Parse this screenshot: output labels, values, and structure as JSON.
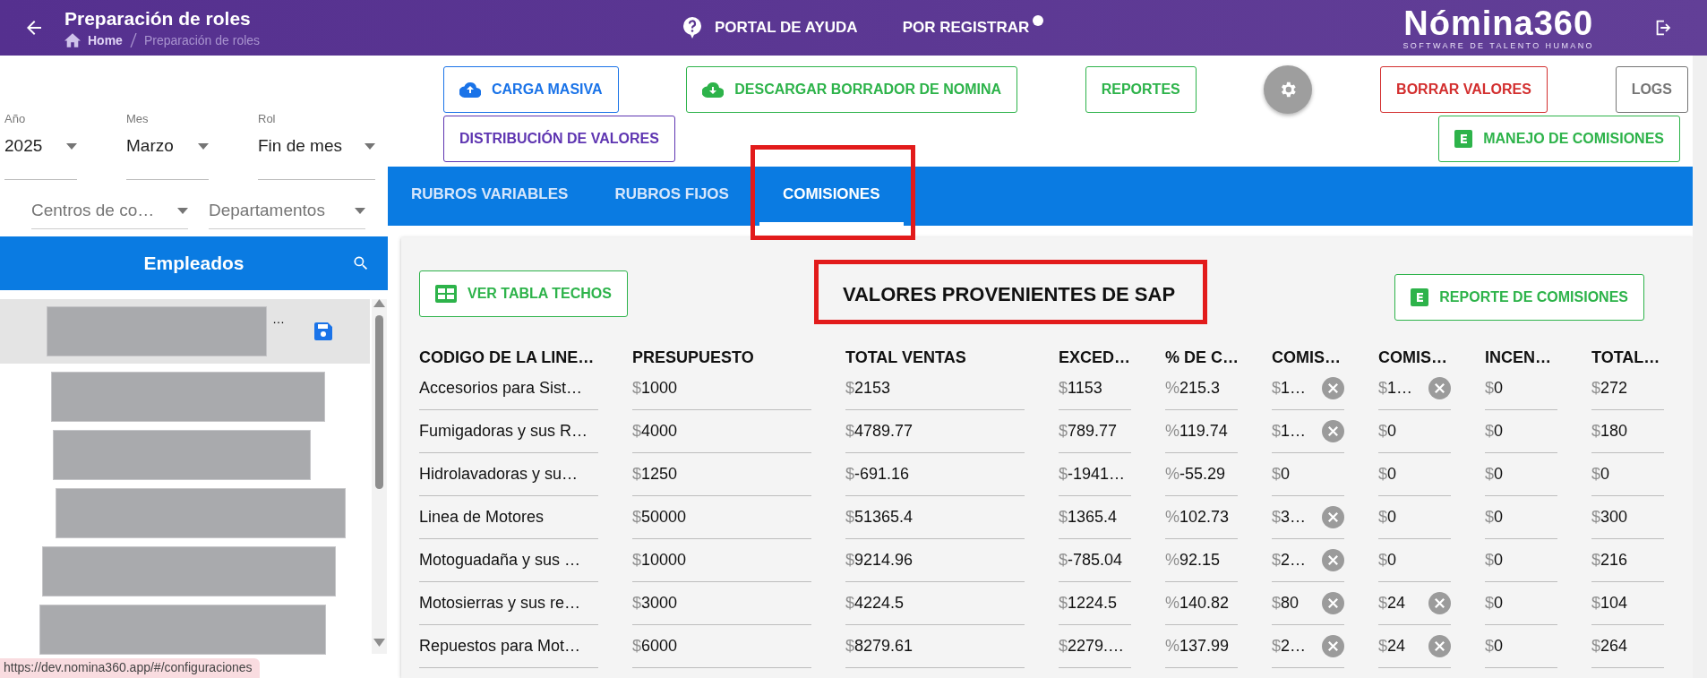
{
  "header": {
    "title": "Preparación de roles",
    "breadcrumb": [
      {
        "label": "Home",
        "selected": false
      },
      {
        "label": "Preparación de roles",
        "selected": true
      }
    ],
    "links": [
      "PORTAL DE AYUDA",
      "POR REGISTRAR"
    ],
    "logo": {
      "name": "Nómina360",
      "tagline": "SOFTWARE DE TALENTO HUMANO"
    }
  },
  "filters": [
    {
      "label": "Año",
      "value": "2025"
    },
    {
      "label": "Mes",
      "value": "Marzo"
    },
    {
      "label": "Rol",
      "value": "Fin de mes"
    }
  ],
  "filters_secondary": [
    {
      "placeholder": "Centros de co…"
    },
    {
      "placeholder": "Departamentos"
    }
  ],
  "employees": {
    "title": "Empleados",
    "items": [
      {
        "selected": true,
        "tail": "…",
        "saved": true
      },
      {
        "selected": false,
        "saved": false
      },
      {
        "selected": false,
        "saved": false
      },
      {
        "selected": false,
        "saved": false
      },
      {
        "selected": false,
        "saved": false
      },
      {
        "selected": false,
        "saved": false
      }
    ]
  },
  "toolbar": [
    {
      "kind": "upload",
      "label": "CARGA MASIVA",
      "color": "#1a73e8"
    },
    {
      "kind": "download",
      "label": "DESCARGAR BORRADOR DE NOMINA",
      "color": "#2db34a"
    },
    {
      "kind": "plain",
      "label": "REPORTES",
      "color": "#2db34a"
    },
    {
      "kind": "gear"
    },
    {
      "kind": "plain",
      "label": "BORRAR VALORES",
      "color": "#d32f2f"
    },
    {
      "kind": "plain",
      "label": "LOGS",
      "color": "#757575"
    }
  ],
  "toolbar_second": [
    {
      "kind": "plain",
      "label": "DISTRIBUCIÓN DE VALORES",
      "color": "#5e35b1"
    },
    {
      "kind": "sheet",
      "label": "MANEJO DE COMISIONES",
      "color": "#2db34a"
    }
  ],
  "tabs": [
    {
      "label": "RUBROS VARIABLES",
      "selected": false,
      "highlighted": false
    },
    {
      "label": "RUBROS FIJOS",
      "selected": false,
      "highlighted": false
    },
    {
      "label": "COMISIONES",
      "selected": true,
      "highlighted": true
    }
  ],
  "panel": {
    "left_button": {
      "kind": "table",
      "label": "VER TABLA TECHOS"
    },
    "title": "VALORES PROVENIENTES DE SAP",
    "title_highlighted": true,
    "right_button": {
      "kind": "sheet",
      "label": "REPORTE DE COMISIONES"
    }
  },
  "table": {
    "columns": [
      "CODIGO DE LA LINE…",
      "PRESUPUESTO",
      "TOTAL VENTAS",
      "EXCED…",
      "% DE C…",
      "COMIS…",
      "COMIS…",
      "INCEN…",
      "TOTAL…"
    ],
    "rows": [
      [
        {
          "value": "Accesorios para Sist…"
        },
        {
          "prefix": "$",
          "value": "1000"
        },
        {
          "prefix": "$",
          "value": "2153"
        },
        {
          "prefix": "$",
          "value": "1153"
        },
        {
          "prefix": "%",
          "value": "215.3"
        },
        {
          "prefix": "$",
          "value": "1…",
          "clearable": true
        },
        {
          "prefix": "$",
          "value": "1…",
          "clearable": true
        },
        {
          "prefix": "$",
          "value": "0"
        },
        {
          "prefix": "$",
          "value": "272"
        }
      ],
      [
        {
          "value": "Fumigadoras y sus R…"
        },
        {
          "prefix": "$",
          "value": "4000"
        },
        {
          "prefix": "$",
          "value": "4789.77"
        },
        {
          "prefix": "$",
          "value": "789.77"
        },
        {
          "prefix": "%",
          "value": "119.74"
        },
        {
          "prefix": "$",
          "value": "1…",
          "clearable": true
        },
        {
          "prefix": "$",
          "value": "0",
          "clearable": false
        },
        {
          "prefix": "$",
          "value": "0"
        },
        {
          "prefix": "$",
          "value": "180"
        }
      ],
      [
        {
          "value": "Hidrolavadoras y su…"
        },
        {
          "prefix": "$",
          "value": "1250"
        },
        {
          "prefix": "$",
          "value": "-691.16"
        },
        {
          "prefix": "$",
          "value": "-1941…"
        },
        {
          "prefix": "%",
          "value": "-55.29"
        },
        {
          "prefix": "$",
          "value": "0",
          "clearable": false
        },
        {
          "prefix": "$",
          "value": "0",
          "clearable": false
        },
        {
          "prefix": "$",
          "value": "0"
        },
        {
          "prefix": "$",
          "value": "0"
        }
      ],
      [
        {
          "value": "Linea de Motores"
        },
        {
          "prefix": "$",
          "value": "50000"
        },
        {
          "prefix": "$",
          "value": "51365.4"
        },
        {
          "prefix": "$",
          "value": "1365.4"
        },
        {
          "prefix": "%",
          "value": "102.73"
        },
        {
          "prefix": "$",
          "value": "3…",
          "clearable": true
        },
        {
          "prefix": "$",
          "value": "0",
          "clearable": false
        },
        {
          "prefix": "$",
          "value": "0"
        },
        {
          "prefix": "$",
          "value": "300"
        }
      ],
      [
        {
          "value": "Motoguadaña y sus …"
        },
        {
          "prefix": "$",
          "value": "10000"
        },
        {
          "prefix": "$",
          "value": "9214.96"
        },
        {
          "prefix": "$",
          "value": "-785.04"
        },
        {
          "prefix": "%",
          "value": "92.15"
        },
        {
          "prefix": "$",
          "value": "2…",
          "clearable": true
        },
        {
          "prefix": "$",
          "value": "0",
          "clearable": false
        },
        {
          "prefix": "$",
          "value": "0"
        },
        {
          "prefix": "$",
          "value": "216"
        }
      ],
      [
        {
          "value": "Motosierras y sus re…"
        },
        {
          "prefix": "$",
          "value": "3000"
        },
        {
          "prefix": "$",
          "value": "4224.5"
        },
        {
          "prefix": "$",
          "value": "1224.5"
        },
        {
          "prefix": "%",
          "value": "140.82"
        },
        {
          "prefix": "$",
          "value": "80",
          "clearable": true
        },
        {
          "prefix": "$",
          "value": "24",
          "clearable": true
        },
        {
          "prefix": "$",
          "value": "0"
        },
        {
          "prefix": "$",
          "value": "104"
        }
      ],
      [
        {
          "value": "Repuestos para Mot…"
        },
        {
          "prefix": "$",
          "value": "6000"
        },
        {
          "prefix": "$",
          "value": "8279.61"
        },
        {
          "prefix": "$",
          "value": "2279.…"
        },
        {
          "prefix": "%",
          "value": "137.99"
        },
        {
          "prefix": "$",
          "value": "2…",
          "clearable": true
        },
        {
          "prefix": "$",
          "value": "24",
          "clearable": true
        },
        {
          "prefix": "$",
          "value": "0"
        },
        {
          "prefix": "$",
          "value": "264"
        }
      ]
    ]
  },
  "status_url": "https://dev.nomina360.app/#/configuraciones"
}
